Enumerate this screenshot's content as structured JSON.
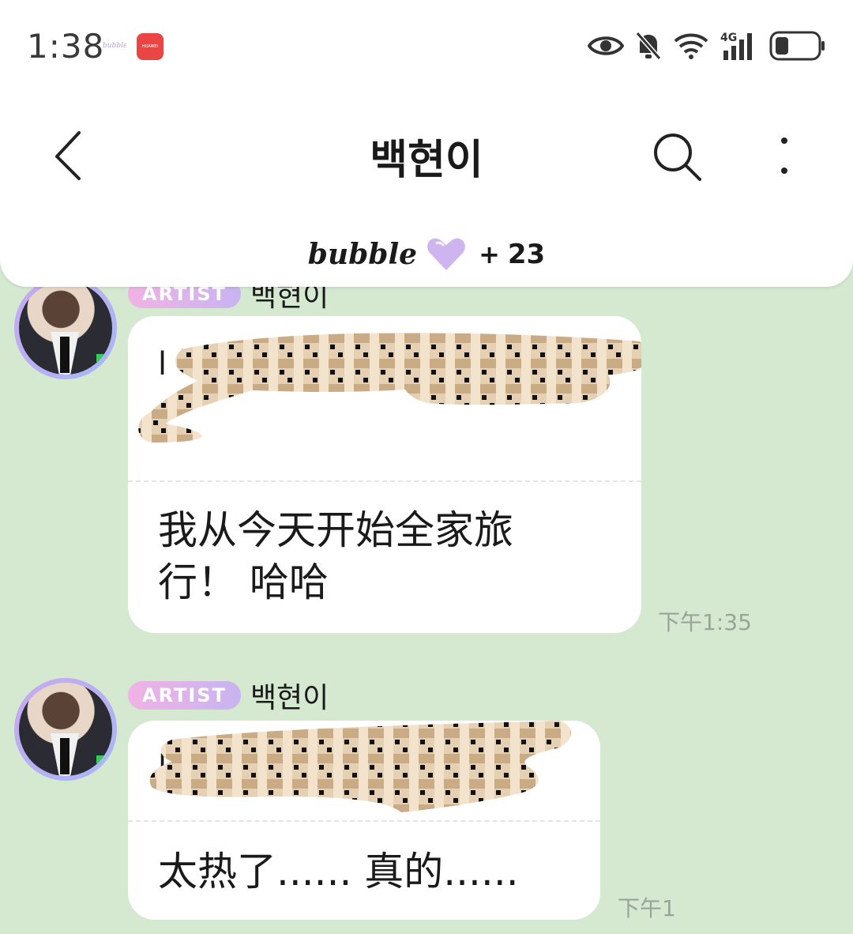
{
  "status_bar": {
    "time": "1:38",
    "notif_huawei_label": "HUAWEI",
    "icons": [
      "eye-icon",
      "bell-muted-icon",
      "wifi-icon",
      "signal-4g-icon",
      "battery-icon"
    ],
    "network_label": "4G"
  },
  "header": {
    "title": "백현이",
    "brand": "bubble",
    "plus": "+",
    "count": "23",
    "icons": [
      "back-icon",
      "search-icon",
      "more-vertical-icon",
      "heart-icon"
    ]
  },
  "messages": [
    {
      "tag": "ARTIST",
      "sender": "백현이",
      "original_prefix": "l",
      "translation_lines": [
        "我从今天开始全家旅",
        "行！ 哈哈"
      ],
      "time": "下午1:35"
    },
    {
      "tag": "ARTIST",
      "sender": "백현이",
      "original_prefix": "l",
      "translation_lines": [
        "太热了...... 真的......"
      ],
      "time": "下午1"
    }
  ],
  "colors": {
    "chat_background": "#d4e9d0",
    "artist_tag_gradient": [
      "#f0b3e3",
      "#c8b4f1"
    ],
    "heart": "#c5a8ec"
  }
}
